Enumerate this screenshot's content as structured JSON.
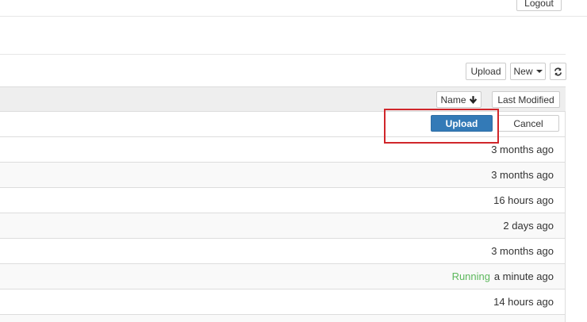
{
  "header": {
    "logout_label": "Logout"
  },
  "toolbar": {
    "upload_label": "Upload",
    "new_label": "New"
  },
  "list_header": {
    "name_label": "Name",
    "last_modified_label": "Last Modified"
  },
  "upload_row": {
    "upload_label": "Upload",
    "cancel_label": "Cancel"
  },
  "rows": [
    {
      "status": "",
      "modified": "3 months ago"
    },
    {
      "status": "",
      "modified": "3 months ago"
    },
    {
      "status": "",
      "modified": "16 hours ago"
    },
    {
      "status": "",
      "modified": "2 days ago"
    },
    {
      "status": "",
      "modified": "3 months ago"
    },
    {
      "status": "Running",
      "modified": "a minute ago"
    },
    {
      "status": "",
      "modified": "14 hours ago"
    }
  ],
  "colors": {
    "primary": "#337ab7",
    "running": "#5cb85c",
    "highlight": "#d0262b"
  },
  "icons": {
    "sort": "arrow-down-icon",
    "refresh": "refresh-icon",
    "dropdown": "caret-down-icon"
  }
}
